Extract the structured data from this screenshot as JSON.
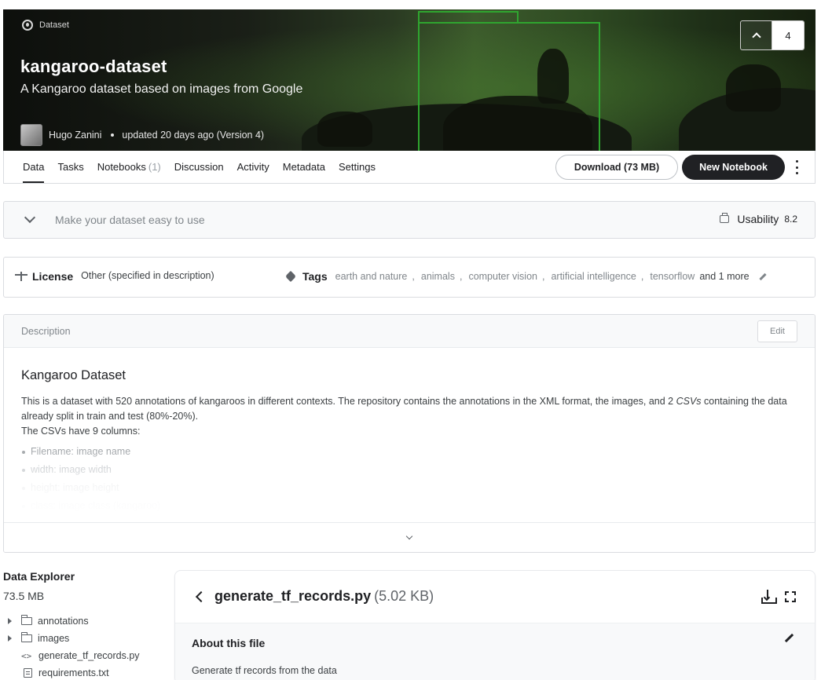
{
  "header": {
    "type_label": "Dataset",
    "title": "kangaroo-dataset",
    "subtitle": "A Kangaroo dataset based on images from Google",
    "author": "Hugo Zanini",
    "updated": "updated 20 days ago (Version 4)",
    "vote_count": "4"
  },
  "tabs": [
    {
      "label": "Data",
      "count": ""
    },
    {
      "label": "Tasks",
      "count": ""
    },
    {
      "label": "Notebooks",
      "count": "(1)"
    },
    {
      "label": "Discussion",
      "count": ""
    },
    {
      "label": "Activity",
      "count": ""
    },
    {
      "label": "Metadata",
      "count": ""
    },
    {
      "label": "Settings",
      "count": ""
    }
  ],
  "actions": {
    "download_label": "Download (73 MB)",
    "new_notebook_label": "New Notebook"
  },
  "usability": {
    "prompt": "Make your dataset easy to use",
    "label": "Usability",
    "score": "8.2"
  },
  "license": {
    "label": "License",
    "value": "Other (specified in description)"
  },
  "tags": {
    "label": "Tags",
    "items": [
      "earth and nature",
      "animals",
      "computer vision",
      "artificial intelligence",
      "tensorflow"
    ],
    "more": "and 1 more"
  },
  "description": {
    "header": "Description",
    "edit_label": "Edit",
    "heading": "Kangaroo Dataset",
    "para1_a": "This is a dataset with 520 annotations of kangaroos in different contexts. The repository contains the annotations in the XML format, the images, and 2 ",
    "para1_em": "CSVs",
    "para1_b": " containing the data already split in train and test (80%-20%).",
    "para2": "The CSVs have 9 columns:",
    "columns": [
      {
        "name": "Filename",
        "desc": ": image name"
      },
      {
        "name": "width",
        "desc": ": image width"
      },
      {
        "name": "height",
        "desc": ": image height"
      },
      {
        "name": "class",
        "desc": ": image class (kangaroo)"
      }
    ]
  },
  "explorer": {
    "title": "Data Explorer",
    "size": "73.5 MB",
    "items": [
      {
        "name": "annotations",
        "kind": "folder"
      },
      {
        "name": "images",
        "kind": "folder"
      },
      {
        "name": "generate_tf_records.py",
        "kind": "code"
      },
      {
        "name": "requirements.txt",
        "kind": "doc"
      }
    ]
  },
  "file": {
    "name": "generate_tf_records.py",
    "size": "(5.02 KB)",
    "about_title": "About this file",
    "about_text": "Generate tf records from the data"
  }
}
